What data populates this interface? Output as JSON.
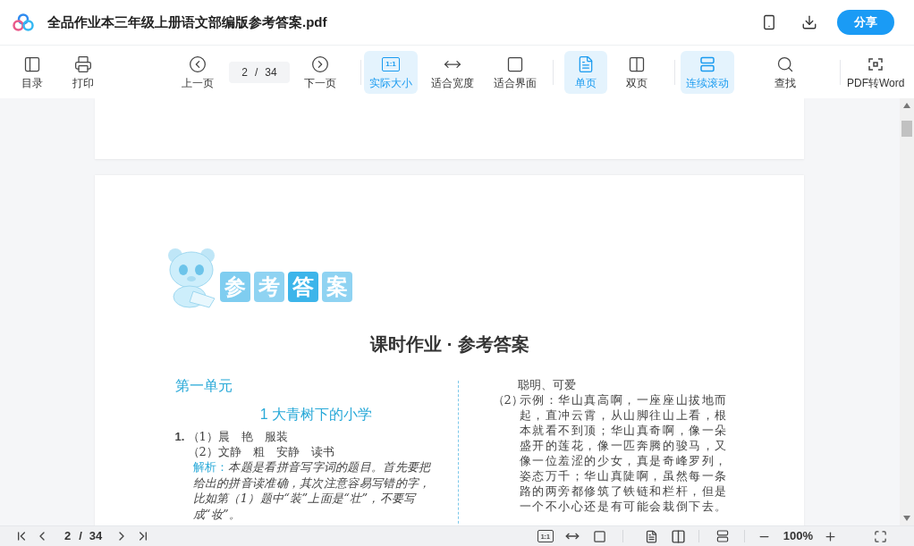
{
  "header": {
    "file_name": "全品作业本三年级上册语文部编版参考答案.pdf",
    "share_button": "分享"
  },
  "toolbar": {
    "items": [
      {
        "kind": "toc",
        "label": "目录",
        "selected": false
      },
      {
        "kind": "print",
        "label": "打印",
        "selected": false
      },
      {
        "kind": "prev",
        "label": "上一页",
        "selected": false
      },
      {
        "kind": "pager",
        "current": "2",
        "separator": "/",
        "total": "34"
      },
      {
        "kind": "next",
        "label": "下一页",
        "selected": false
      },
      {
        "kind": "actual",
        "icon_text": "1:1",
        "label": "实际大小",
        "selected": true
      },
      {
        "kind": "fitwidth",
        "label": "适合宽度",
        "selected": false
      },
      {
        "kind": "fitpage",
        "label": "适合界面",
        "selected": false
      },
      {
        "kind": "single",
        "label": "单页",
        "selected": true
      },
      {
        "kind": "double",
        "label": "双页",
        "selected": false
      },
      {
        "kind": "scroll",
        "label": "连续滚动",
        "selected": true
      },
      {
        "kind": "find",
        "label": "查找",
        "selected": false
      },
      {
        "kind": "convert",
        "label": "PDF转Word",
        "selected": false
      }
    ]
  },
  "document": {
    "logo_tiles": [
      "参",
      "考",
      "答",
      "案"
    ],
    "title": "课时作业 · 参考答案",
    "unit": "第一单元",
    "lesson": "1 大青树下的小学",
    "left_lines": [
      {
        "kind": "numbered",
        "number": "1.",
        "text": "（1）晨　艳　服装"
      },
      {
        "kind": "plain",
        "text": "（2）文静　粗　安静　读书"
      },
      {
        "kind": "analysis",
        "label": "解析：",
        "text": "本题是看拼音写字词的题目。首先要把给出的拼音读准确，其次注意容易写错的字，比如第（1）题中“装”上面是“壮”，不要写成“妆”。"
      }
    ],
    "right_lines": [
      {
        "kind": "continued",
        "text": "聪明、可爱"
      },
      {
        "kind": "item",
        "number": "（2）",
        "text": "示例：华山真高啊，一座座山拔地而起，直冲云霄，从山脚往山上看，根本就看不到顶；华山真奇啊，像一朵盛开的莲花，像一匹奔腾的骏马，又像一位羞涩的少女，真是奇峰罗列，姿态万千；华山真陡啊，虽然每一条路的两旁都修筑了铁链和栏杆，但是一个不小心还是有可能会栽倒下去。"
      }
    ]
  },
  "bottom_bar": {
    "current": "2",
    "separator": "/",
    "total": "34",
    "actual_icon_text": "1:1",
    "zoom": "100%"
  }
}
